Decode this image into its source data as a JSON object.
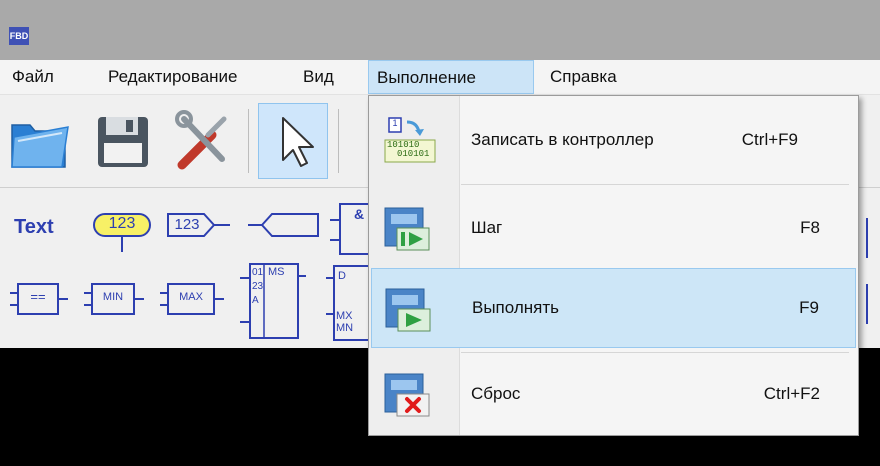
{
  "app": {
    "icon_text": "FBD"
  },
  "menubar": {
    "items": [
      {
        "label": "Файл"
      },
      {
        "label": "Редактирование"
      },
      {
        "label": "Вид"
      },
      {
        "label": "Выполнение"
      },
      {
        "label": "Справка"
      }
    ],
    "active": "Выполнение"
  },
  "toolbar": {
    "buttons": [
      {
        "icon": "open-folder-icon"
      },
      {
        "icon": "save-icon"
      },
      {
        "icon": "tools-icon"
      },
      {
        "icon": "pointer-icon",
        "pressed": true
      }
    ]
  },
  "palette": {
    "row1": {
      "text_label": "Text",
      "const_value": "123",
      "input_value": "123",
      "and_symbol": "&"
    },
    "row2": {
      "eq": "==",
      "min": "MIN",
      "max": "MAX",
      "ms_digits": "0123A",
      "ms_label": "MS",
      "d_label": "D",
      "mx_label": "MX",
      "mn_label": "MN"
    }
  },
  "run_menu": {
    "items": [
      {
        "label": "Записать в контроллер",
        "shortcut": "Ctrl+F9",
        "icon": "write-to-controller-icon",
        "binary_top": "101010",
        "binary_bottom": "010101",
        "badge": "1"
      },
      {
        "label": "Шаг",
        "shortcut": "F8",
        "icon": "step-icon"
      },
      {
        "label": "Выполнять",
        "shortcut": "F9",
        "icon": "run-icon",
        "hovered": true
      },
      {
        "label": "Сброс",
        "shortcut": "Ctrl+F2",
        "icon": "reset-icon"
      }
    ]
  },
  "colors": {
    "accent": "#cce4f7",
    "palette_blue": "#2d3fb0",
    "play_green": "#2ea043",
    "stop_red": "#e11b1b",
    "const_yellow": "#f7f066"
  }
}
